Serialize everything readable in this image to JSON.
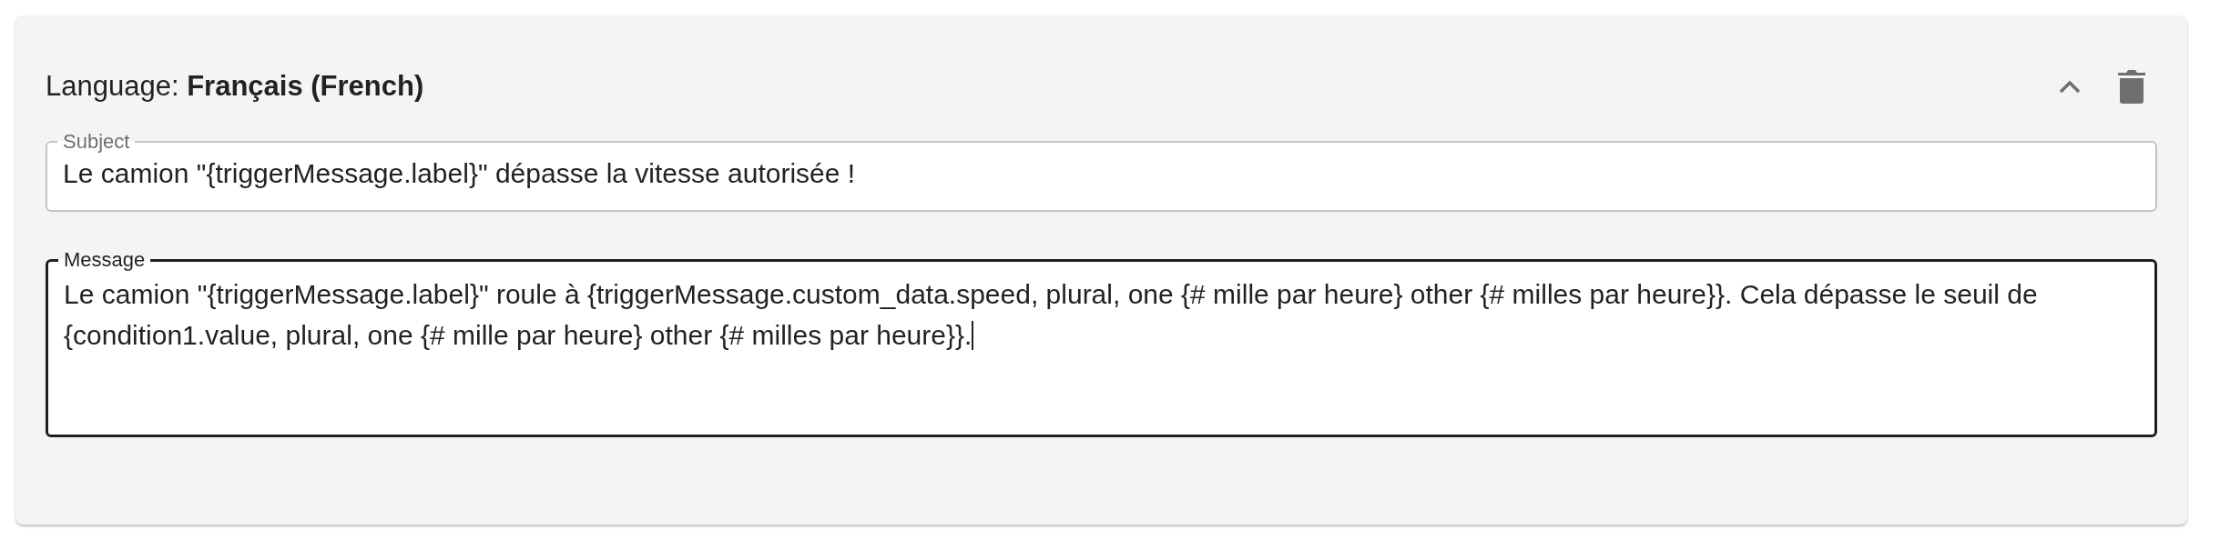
{
  "card": {
    "heading": "Language: **Français (French)**",
    "expanded": true,
    "fields": [
      {
        "label": "Subject",
        "value": "Le camion \"{triggerMessage.label}\" dépasse la vitesse autorisée !",
        "focused": false,
        "kind": "input"
      },
      {
        "label": "Message",
        "value": "Le camion \"{triggerMessage.label}\" roule à {triggerMessage.custom_data.speed, plural, one {# mille par heure} other {# milles par heure}}. Cela dépasse le seuil de {condition1.value, plural, one {# mille par heure} other {# milles par heure}}.",
        "focused": true,
        "kind": "textarea"
      }
    ]
  }
}
